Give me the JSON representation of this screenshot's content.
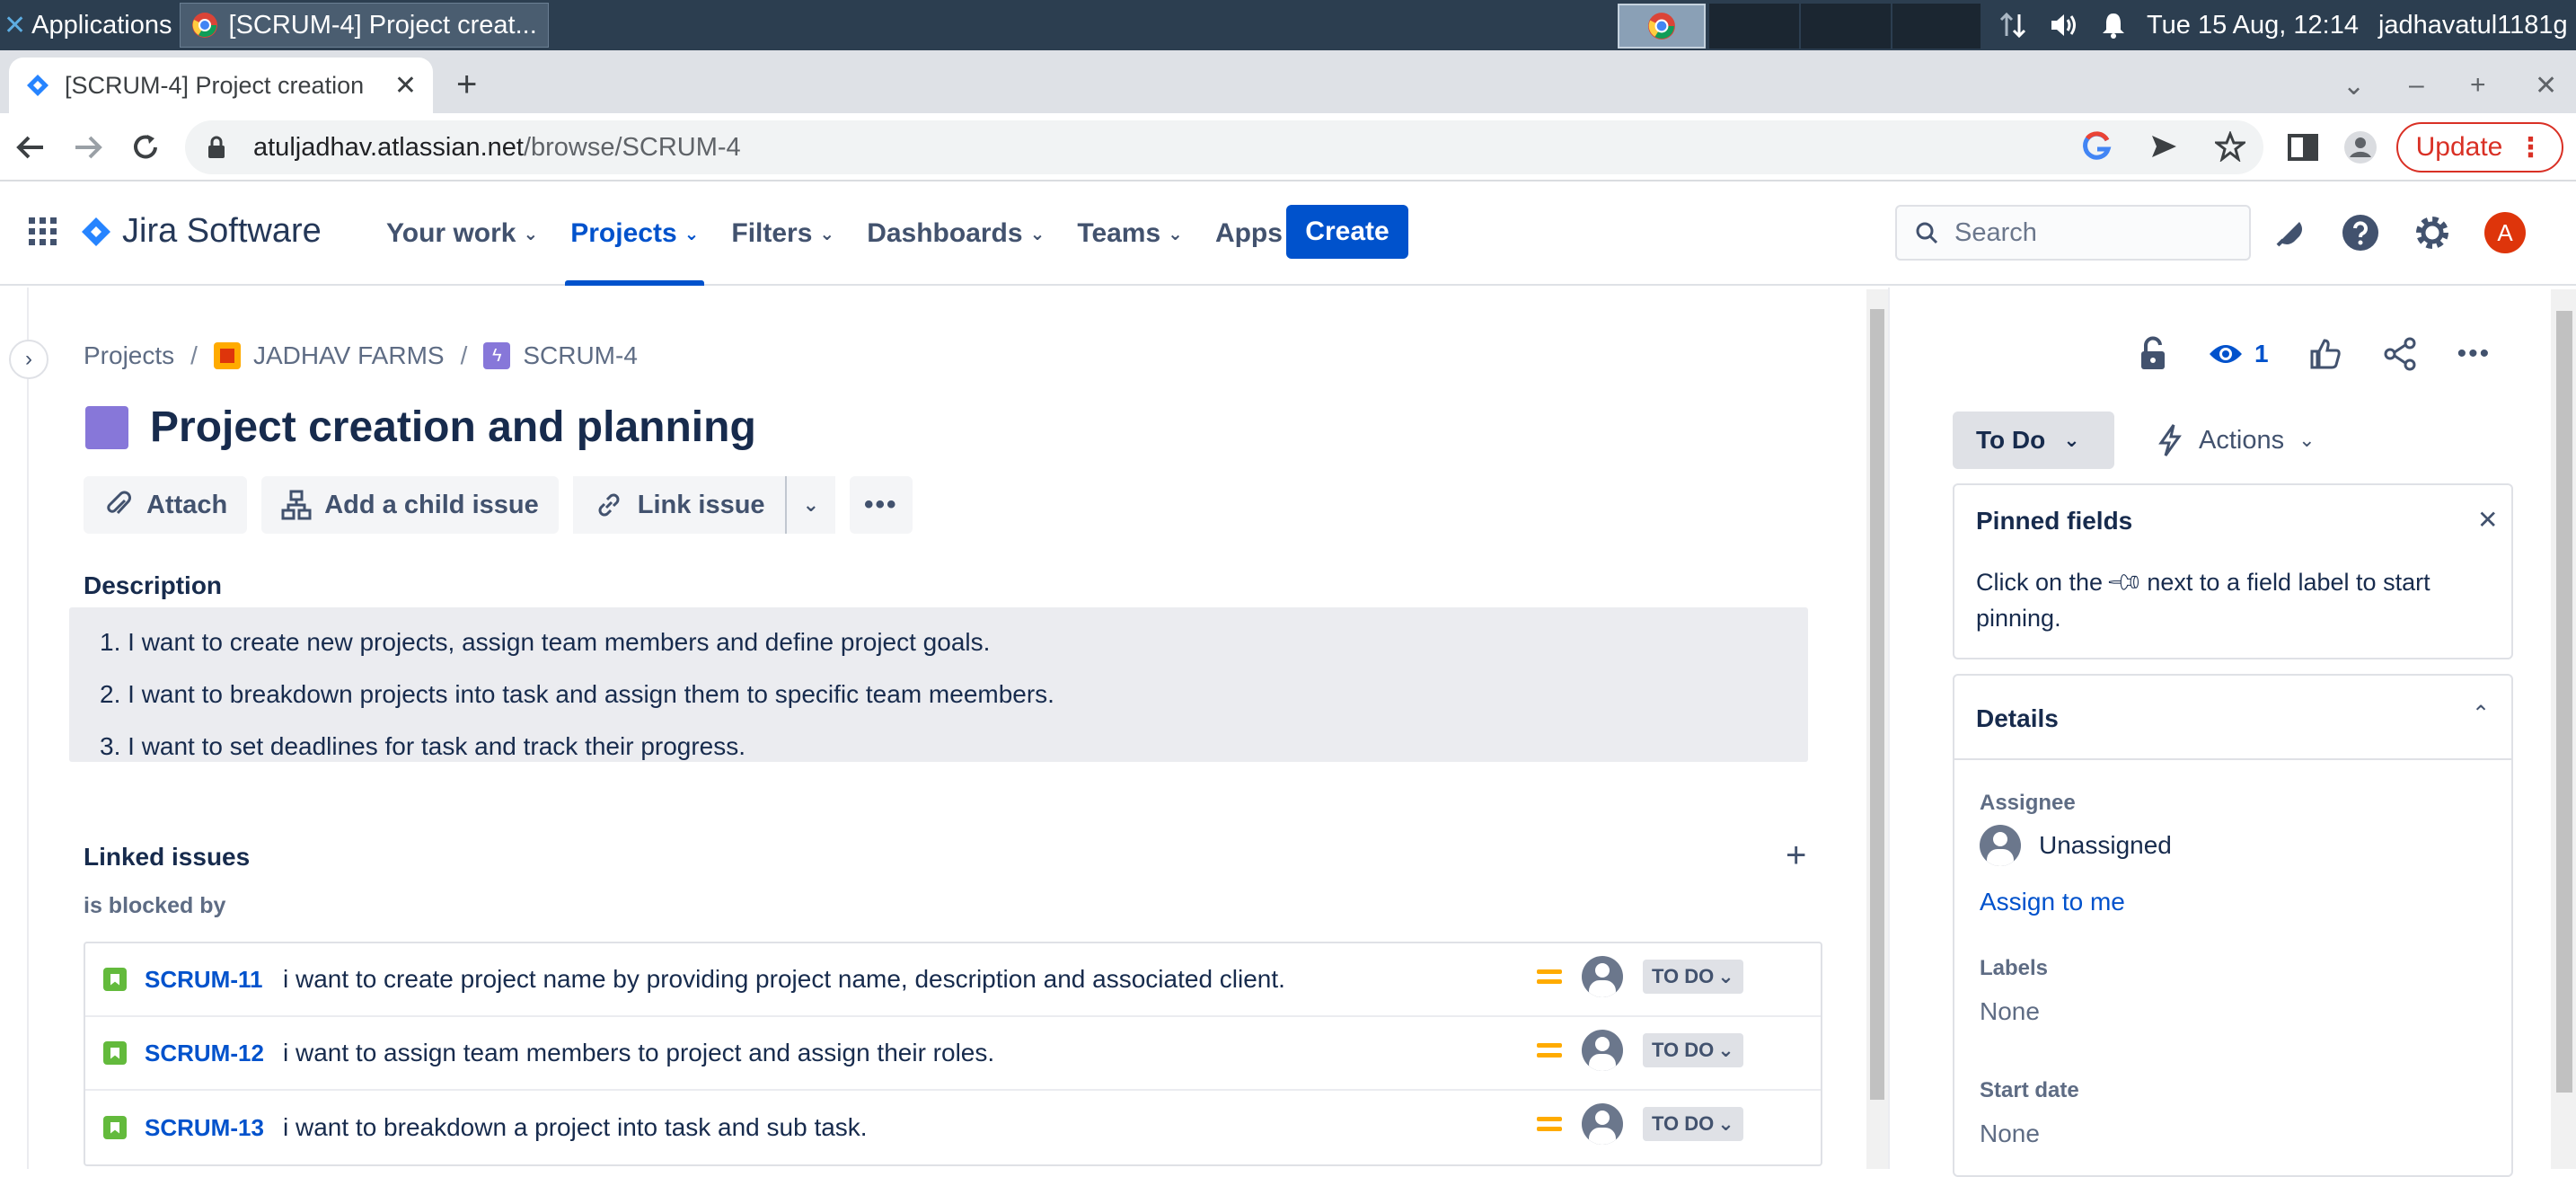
{
  "os": {
    "apps_label": "Applications",
    "window_title": "[SCRUM-4] Project creat...",
    "clock": "Tue 15 Aug, 12:14",
    "user": "jadhavatul1181g"
  },
  "browser": {
    "tab_title": "[SCRUM-4] Project creation",
    "url_host": "atuljadhav.atlassian.net",
    "url_path": "/browse/SCRUM-4",
    "update_label": "Update"
  },
  "jira": {
    "brand": "Jira Software",
    "nav": [
      "Your work",
      "Projects",
      "Filters",
      "Dashboards",
      "Teams",
      "Apps"
    ],
    "create_label": "Create",
    "search_placeholder": "Search",
    "avatar_initial": "A"
  },
  "issue": {
    "breadcrumb": [
      "Projects",
      "JADHAV FARMS",
      "SCRUM-4"
    ],
    "title": "Project creation and planning",
    "actions": {
      "attach": "Attach",
      "add_child": "Add a child issue",
      "link": "Link issue"
    },
    "description_heading": "Description",
    "description": [
      "1. I want to create new projects, assign team members and define project goals.",
      "2. I want to breakdown projects into task and assign them to specific team meembers.",
      "3. I want to set deadlines for task and track their progress."
    ],
    "linked_heading": "Linked issues",
    "blocked_by_label": "is blocked by",
    "linked": [
      {
        "key": "SCRUM-11",
        "summary": "i want to create project name by providing project name, description and associated client.",
        "status": "TO DO"
      },
      {
        "key": "SCRUM-12",
        "summary": "i want to assign team members to project and assign their roles.",
        "status": "TO DO"
      },
      {
        "key": "SCRUM-13",
        "summary": "i want to breakdown a project into task and sub task.",
        "status": "TO DO"
      }
    ]
  },
  "panel": {
    "watch_count": "1",
    "status": "To Do",
    "actions_label": "Actions",
    "pinned_title": "Pinned fields",
    "pinned_text_1": "Click on the",
    "pinned_text_2": "next to a field label to",
    "pinned_text_3": "start pinning.",
    "details_title": "Details",
    "assignee_label": "Assignee",
    "assignee_value": "Unassigned",
    "assign_to_me": "Assign to me",
    "labels_label": "Labels",
    "labels_value": "None",
    "start_label": "Start date",
    "start_value": "None"
  },
  "colors": {
    "brand_blue": "#0052cc",
    "epic_purple": "#8777d9",
    "story_green": "#63ba3c",
    "priority_medium": "#ffab00",
    "avatar_red": "#de350b"
  }
}
